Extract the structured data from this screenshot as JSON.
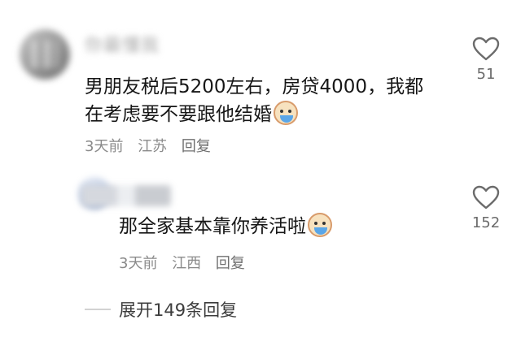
{
  "comments": [
    {
      "username": "你最懂我",
      "text_lines": [
        "男朋友税后5200左右，房贷4000，我都",
        "在考虑要不要跟他结婚"
      ],
      "emoji": "crying-face",
      "time": "3天前",
      "location": "江苏",
      "reply_label": "回复",
      "likes": "51"
    }
  ],
  "replies": [
    {
      "username": "",
      "text": "那全家基本靠你养活啦",
      "emoji": "crying-face",
      "time": "3天前",
      "location": "江西",
      "reply_label": "回复",
      "likes": "152"
    }
  ],
  "expand_label": "展开149条回复",
  "icons": {
    "like": "heart-outline-icon",
    "emoji": "crying-face-emoji-icon"
  },
  "colors": {
    "text": "#161616",
    "meta": "#8a8a8a",
    "like_count": "#6b6b6b"
  }
}
